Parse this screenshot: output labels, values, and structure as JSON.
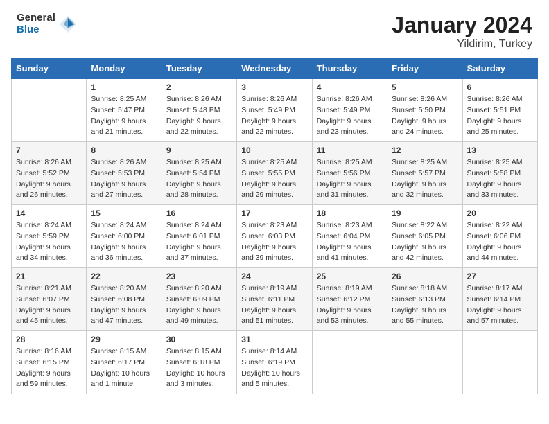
{
  "header": {
    "logo_general": "General",
    "logo_blue": "Blue",
    "title": "January 2024",
    "subtitle": "Yildirim, Turkey"
  },
  "days_of_week": [
    "Sunday",
    "Monday",
    "Tuesday",
    "Wednesday",
    "Thursday",
    "Friday",
    "Saturday"
  ],
  "weeks": [
    [
      {
        "day": "",
        "sunrise": "",
        "sunset": "",
        "daylight": ""
      },
      {
        "day": "1",
        "sunrise": "Sunrise: 8:25 AM",
        "sunset": "Sunset: 5:47 PM",
        "daylight": "Daylight: 9 hours and 21 minutes."
      },
      {
        "day": "2",
        "sunrise": "Sunrise: 8:26 AM",
        "sunset": "Sunset: 5:48 PM",
        "daylight": "Daylight: 9 hours and 22 minutes."
      },
      {
        "day": "3",
        "sunrise": "Sunrise: 8:26 AM",
        "sunset": "Sunset: 5:49 PM",
        "daylight": "Daylight: 9 hours and 22 minutes."
      },
      {
        "day": "4",
        "sunrise": "Sunrise: 8:26 AM",
        "sunset": "Sunset: 5:49 PM",
        "daylight": "Daylight: 9 hours and 23 minutes."
      },
      {
        "day": "5",
        "sunrise": "Sunrise: 8:26 AM",
        "sunset": "Sunset: 5:50 PM",
        "daylight": "Daylight: 9 hours and 24 minutes."
      },
      {
        "day": "6",
        "sunrise": "Sunrise: 8:26 AM",
        "sunset": "Sunset: 5:51 PM",
        "daylight": "Daylight: 9 hours and 25 minutes."
      }
    ],
    [
      {
        "day": "7",
        "sunrise": "Sunrise: 8:26 AM",
        "sunset": "Sunset: 5:52 PM",
        "daylight": "Daylight: 9 hours and 26 minutes."
      },
      {
        "day": "8",
        "sunrise": "Sunrise: 8:26 AM",
        "sunset": "Sunset: 5:53 PM",
        "daylight": "Daylight: 9 hours and 27 minutes."
      },
      {
        "day": "9",
        "sunrise": "Sunrise: 8:25 AM",
        "sunset": "Sunset: 5:54 PM",
        "daylight": "Daylight: 9 hours and 28 minutes."
      },
      {
        "day": "10",
        "sunrise": "Sunrise: 8:25 AM",
        "sunset": "Sunset: 5:55 PM",
        "daylight": "Daylight: 9 hours and 29 minutes."
      },
      {
        "day": "11",
        "sunrise": "Sunrise: 8:25 AM",
        "sunset": "Sunset: 5:56 PM",
        "daylight": "Daylight: 9 hours and 31 minutes."
      },
      {
        "day": "12",
        "sunrise": "Sunrise: 8:25 AM",
        "sunset": "Sunset: 5:57 PM",
        "daylight": "Daylight: 9 hours and 32 minutes."
      },
      {
        "day": "13",
        "sunrise": "Sunrise: 8:25 AM",
        "sunset": "Sunset: 5:58 PM",
        "daylight": "Daylight: 9 hours and 33 minutes."
      }
    ],
    [
      {
        "day": "14",
        "sunrise": "Sunrise: 8:24 AM",
        "sunset": "Sunset: 5:59 PM",
        "daylight": "Daylight: 9 hours and 34 minutes."
      },
      {
        "day": "15",
        "sunrise": "Sunrise: 8:24 AM",
        "sunset": "Sunset: 6:00 PM",
        "daylight": "Daylight: 9 hours and 36 minutes."
      },
      {
        "day": "16",
        "sunrise": "Sunrise: 8:24 AM",
        "sunset": "Sunset: 6:01 PM",
        "daylight": "Daylight: 9 hours and 37 minutes."
      },
      {
        "day": "17",
        "sunrise": "Sunrise: 8:23 AM",
        "sunset": "Sunset: 6:03 PM",
        "daylight": "Daylight: 9 hours and 39 minutes."
      },
      {
        "day": "18",
        "sunrise": "Sunrise: 8:23 AM",
        "sunset": "Sunset: 6:04 PM",
        "daylight": "Daylight: 9 hours and 41 minutes."
      },
      {
        "day": "19",
        "sunrise": "Sunrise: 8:22 AM",
        "sunset": "Sunset: 6:05 PM",
        "daylight": "Daylight: 9 hours and 42 minutes."
      },
      {
        "day": "20",
        "sunrise": "Sunrise: 8:22 AM",
        "sunset": "Sunset: 6:06 PM",
        "daylight": "Daylight: 9 hours and 44 minutes."
      }
    ],
    [
      {
        "day": "21",
        "sunrise": "Sunrise: 8:21 AM",
        "sunset": "Sunset: 6:07 PM",
        "daylight": "Daylight: 9 hours and 45 minutes."
      },
      {
        "day": "22",
        "sunrise": "Sunrise: 8:20 AM",
        "sunset": "Sunset: 6:08 PM",
        "daylight": "Daylight: 9 hours and 47 minutes."
      },
      {
        "day": "23",
        "sunrise": "Sunrise: 8:20 AM",
        "sunset": "Sunset: 6:09 PM",
        "daylight": "Daylight: 9 hours and 49 minutes."
      },
      {
        "day": "24",
        "sunrise": "Sunrise: 8:19 AM",
        "sunset": "Sunset: 6:11 PM",
        "daylight": "Daylight: 9 hours and 51 minutes."
      },
      {
        "day": "25",
        "sunrise": "Sunrise: 8:19 AM",
        "sunset": "Sunset: 6:12 PM",
        "daylight": "Daylight: 9 hours and 53 minutes."
      },
      {
        "day": "26",
        "sunrise": "Sunrise: 8:18 AM",
        "sunset": "Sunset: 6:13 PM",
        "daylight": "Daylight: 9 hours and 55 minutes."
      },
      {
        "day": "27",
        "sunrise": "Sunrise: 8:17 AM",
        "sunset": "Sunset: 6:14 PM",
        "daylight": "Daylight: 9 hours and 57 minutes."
      }
    ],
    [
      {
        "day": "28",
        "sunrise": "Sunrise: 8:16 AM",
        "sunset": "Sunset: 6:15 PM",
        "daylight": "Daylight: 9 hours and 59 minutes."
      },
      {
        "day": "29",
        "sunrise": "Sunrise: 8:15 AM",
        "sunset": "Sunset: 6:17 PM",
        "daylight": "Daylight: 10 hours and 1 minute."
      },
      {
        "day": "30",
        "sunrise": "Sunrise: 8:15 AM",
        "sunset": "Sunset: 6:18 PM",
        "daylight": "Daylight: 10 hours and 3 minutes."
      },
      {
        "day": "31",
        "sunrise": "Sunrise: 8:14 AM",
        "sunset": "Sunset: 6:19 PM",
        "daylight": "Daylight: 10 hours and 5 minutes."
      },
      {
        "day": "",
        "sunrise": "",
        "sunset": "",
        "daylight": ""
      },
      {
        "day": "",
        "sunrise": "",
        "sunset": "",
        "daylight": ""
      },
      {
        "day": "",
        "sunrise": "",
        "sunset": "",
        "daylight": ""
      }
    ]
  ]
}
